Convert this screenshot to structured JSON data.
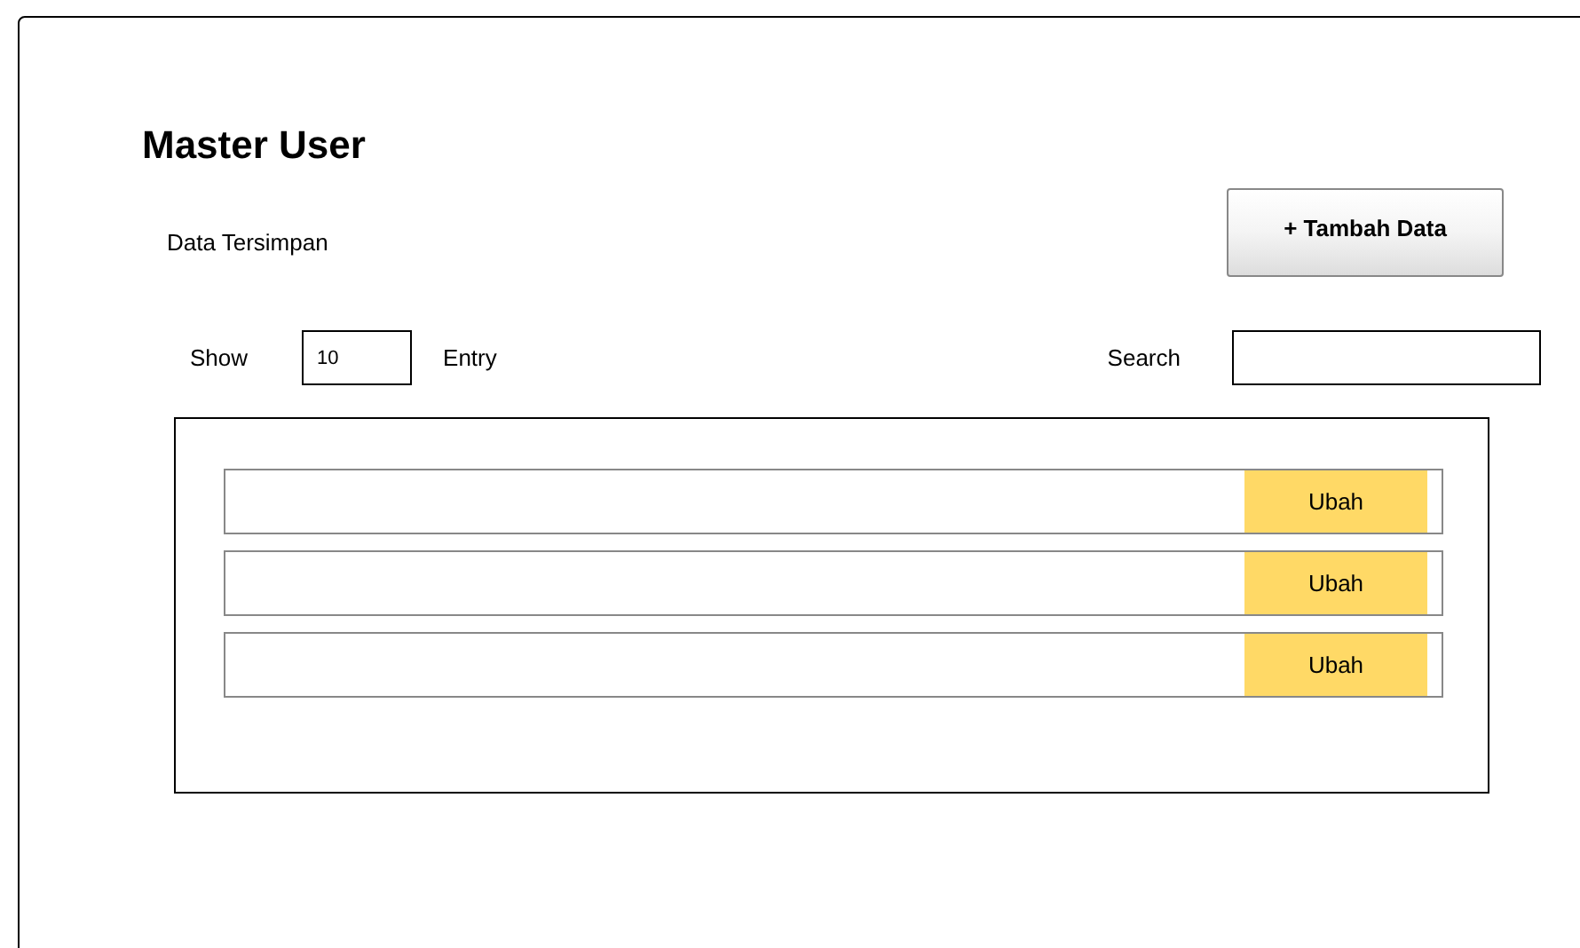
{
  "title": "Master User",
  "subtitle": "Data Tersimpan",
  "add_button": "+ Tambah Data",
  "show": {
    "label": "Show",
    "value": "10",
    "suffix": "Entry"
  },
  "search": {
    "label": "Search"
  },
  "rows": [
    {
      "action": "Ubah"
    },
    {
      "action": "Ubah"
    },
    {
      "action": "Ubah"
    }
  ]
}
